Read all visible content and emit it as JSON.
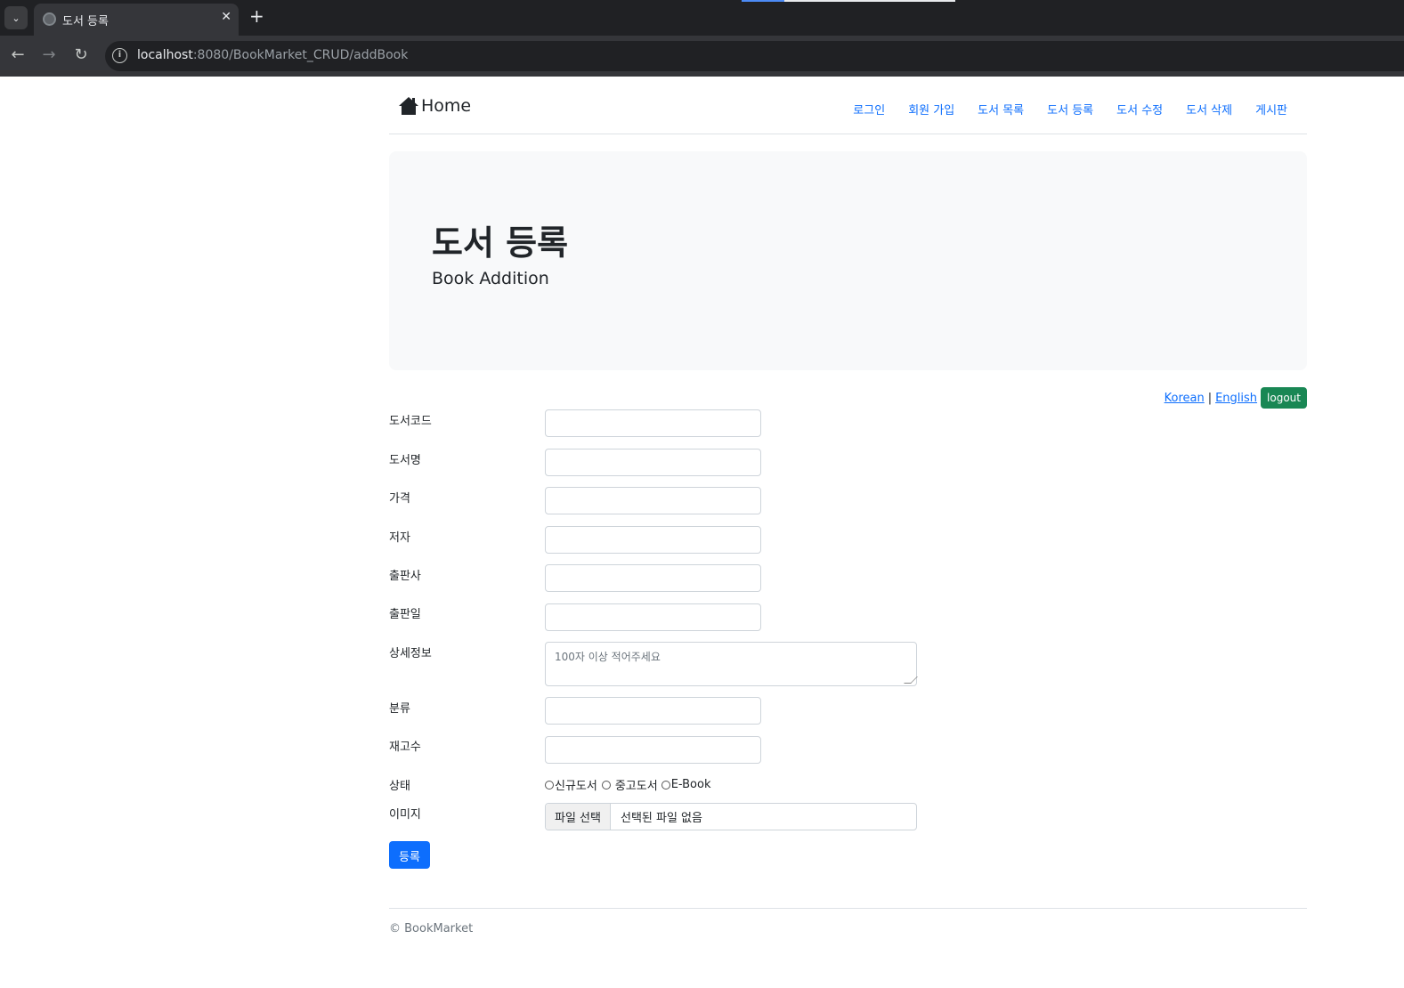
{
  "browser": {
    "tab_title": "도서 등록",
    "url_host": "localhost",
    "url_rest": ":8080/BookMarket_CRUD/addBook",
    "new_tab": "+",
    "close": "✕",
    "tab_menu": "⌄"
  },
  "navbar": {
    "brand": "Home",
    "links": [
      "로그인",
      "회원 가입",
      "도서 목록",
      "도서 등록",
      "도서 수정",
      "도서 삭제",
      "게시판"
    ]
  },
  "jumbotron": {
    "title": "도서 등록",
    "subtitle": "Book Addition"
  },
  "lang": {
    "korean": "Korean",
    "separator": "|",
    "english": "English",
    "logout": "logout"
  },
  "form": {
    "fields": [
      {
        "label": "도서코드",
        "value": ""
      },
      {
        "label": "도서명",
        "value": ""
      },
      {
        "label": "가격",
        "value": ""
      },
      {
        "label": "저자",
        "value": ""
      },
      {
        "label": "출판사",
        "value": ""
      },
      {
        "label": "출판일",
        "value": ""
      },
      {
        "label": "상세정보",
        "placeholder": "100자 이상 적어주세요"
      },
      {
        "label": "분류",
        "value": ""
      },
      {
        "label": "재고수",
        "value": ""
      },
      {
        "label": "상태"
      },
      {
        "label": "이미지"
      }
    ],
    "condition_options": [
      "신규도서",
      "중고도서",
      "E-Book"
    ],
    "file_button": "파일 선택",
    "file_status": "선택된 파일 없음",
    "submit": "등록"
  },
  "footer": {
    "text": "© BookMarket"
  },
  "colors": {
    "primary": "#0d6efd",
    "success": "#198754",
    "jumbotron_bg": "#f8f9fa"
  }
}
